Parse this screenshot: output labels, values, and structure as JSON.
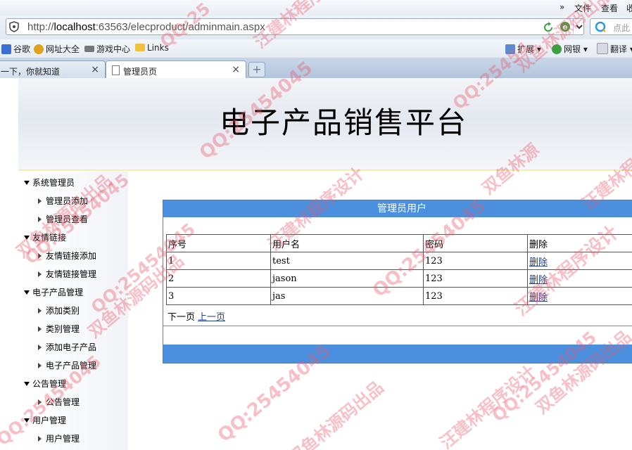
{
  "menu": {
    "overflow": "»",
    "file": "文件",
    "view": "查看",
    "extra": "收"
  },
  "address": {
    "scheme": "http://",
    "host": "localhost",
    "rest": ":63563/elecproduct/adminmain.aspx"
  },
  "search": {
    "label": "点此"
  },
  "bookmarks": [
    {
      "label": "谷歌",
      "icon": "google-icon",
      "color": "#3b6fd4"
    },
    {
      "label": "网址大全",
      "icon": "site-list-icon",
      "color": "#e0a020"
    },
    {
      "label": "游戏中心",
      "icon": "gamepad-icon",
      "color": "#555555"
    },
    {
      "label": "Links",
      "icon": "folder-icon",
      "color": "#f0c040"
    }
  ],
  "toolbar_right": [
    {
      "label": "扩展",
      "icon": "grid-icon"
    },
    {
      "label": "网银",
      "icon": "bank-icon"
    },
    {
      "label": "翻译",
      "icon": "translate-icon"
    }
  ],
  "tabs": [
    {
      "label": "一下，你就知道",
      "close": "×"
    },
    {
      "label": "管理员页",
      "close": "×"
    }
  ],
  "new_tab": "+",
  "site": {
    "title": "电子产品销售平台"
  },
  "nav": [
    {
      "group": "系统管理员",
      "items": [
        "管理员添加",
        "管理员查看"
      ]
    },
    {
      "group": "友情链接",
      "items": [
        "友情链接添加",
        "友情链接管理"
      ]
    },
    {
      "group": "电子产品管理",
      "items": [
        "添加类别",
        "类别管理",
        "添加电子产品",
        "电子产品管理"
      ]
    },
    {
      "group": "公告管理",
      "items": [
        "公告管理"
      ]
    },
    {
      "group": "用户管理",
      "items": [
        "用户管理"
      ]
    }
  ],
  "panel": {
    "title": "管理员用户",
    "headers": [
      "序号",
      "用户名",
      "密码",
      "删除"
    ],
    "rows": [
      {
        "id": "1",
        "username": "test",
        "password": "123",
        "action": "删除"
      },
      {
        "id": "2",
        "username": "jason",
        "password": "123",
        "action": "删除"
      },
      {
        "id": "3",
        "username": "jas",
        "password": "123",
        "action": "删除"
      }
    ],
    "pager": {
      "next": "下一页",
      "prev": "上一页"
    }
  },
  "watermarks": [
    "QQ:25",
    "汪建林程序设",
    "双鱼林源码出品",
    "QQ:25454",
    "QQ:25454045",
    "汪建林程序设计",
    "双鱼林源码出品",
    "QQ:25454045",
    "双鱼林源",
    "汪建林程序设计",
    "QQ:25454045",
    "双鱼林源码出品",
    "QQ:25454045",
    "双鱼林源码出品",
    "汪建林程序设计",
    "QQ:25454045",
    "汪建林程序设计",
    "QQ:25454045",
    "双鱼林源码出品",
    "QQ:25454045"
  ],
  "colors": {
    "panel_header": "#4a90df",
    "link": "#1f3f8f",
    "watermark": "#eb5a6e"
  }
}
